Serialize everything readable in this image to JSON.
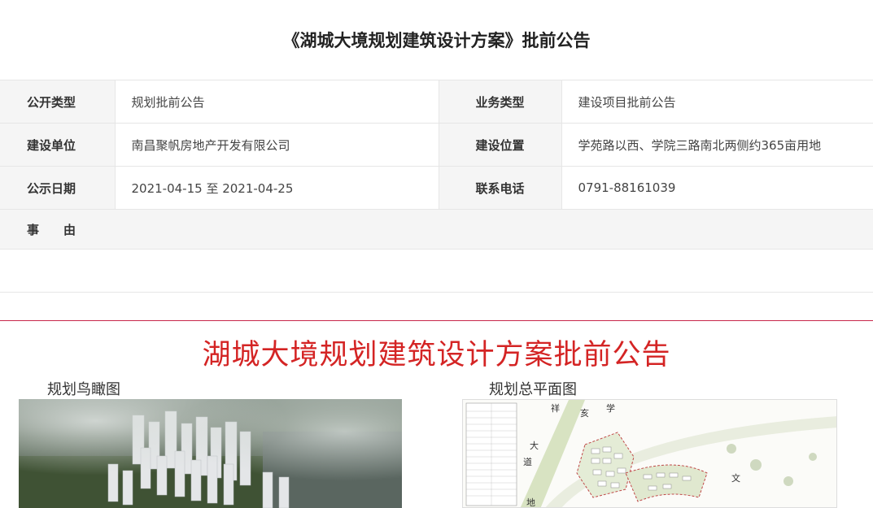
{
  "page": {
    "title": "《湖城大境规划建筑设计方案》批前公告"
  },
  "info": {
    "rows": [
      {
        "k1": "公开类型",
        "v1": "规划批前公告",
        "k2": "业务类型",
        "v2": "建设项目批前公告"
      },
      {
        "k1": "建设单位",
        "v1": "南昌聚帆房地产开发有限公司",
        "k2": "建设位置",
        "v2": "学苑路以西、学院三路南北两侧约365亩用地"
      },
      {
        "k1": "公示日期",
        "v1": "2021-04-15 至 2021-04-25",
        "k2": "联系电话",
        "v2": "0791-88161039"
      }
    ],
    "reason_label": "事由"
  },
  "notice": {
    "title": "湖城大境规划建筑设计方案批前公告",
    "aerial_caption": "规划鸟瞰图",
    "siteplan_caption": "规划总平面图",
    "map_labels": [
      "祥",
      "亥",
      "大",
      "道",
      "学",
      "文",
      "地"
    ]
  }
}
